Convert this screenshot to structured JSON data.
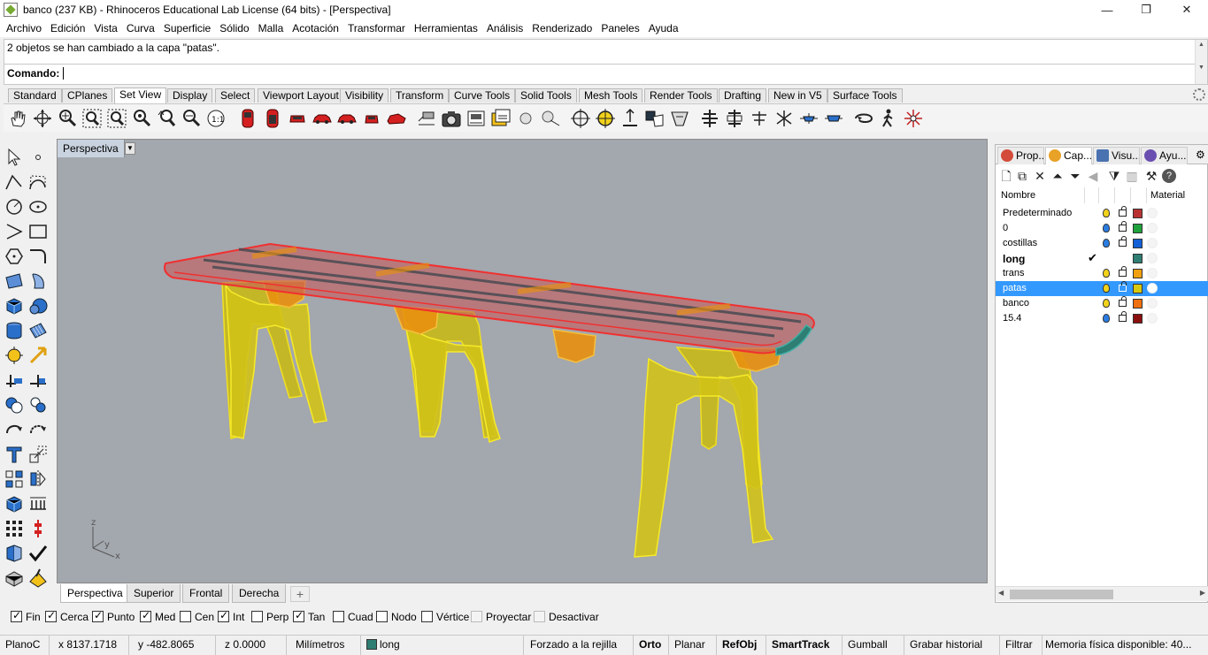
{
  "window": {
    "title": "banco (237 KB) - Rhinoceros Educational Lab License (64 bits) - [Perspectiva]"
  },
  "menu": [
    "Archivo",
    "Edición",
    "Vista",
    "Curva",
    "Superficie",
    "Sólido",
    "Malla",
    "Acotación",
    "Transformar",
    "Herramientas",
    "Análisis",
    "Renderizado",
    "Paneles",
    "Ayuda"
  ],
  "command": {
    "history": "2 objetos se han cambiado a la capa \"patas\".",
    "prompt": "Comando:"
  },
  "tabs": [
    "Standard",
    "CPlanes",
    "Set View",
    "Display",
    "Select",
    "Viewport Layout",
    "Visibility",
    "Transform",
    "Curve Tools",
    "Solid Tools",
    "Mesh Tools",
    "Render Tools",
    "Drafting",
    "New in V5",
    "Surface Tools"
  ],
  "active_tab": "Set View",
  "viewport": {
    "title": "Perspectiva",
    "axes": {
      "z": "z",
      "y": "y",
      "x": "x"
    }
  },
  "viewport_tabs": [
    "Perspectiva",
    "Superior",
    "Frontal",
    "Derecha"
  ],
  "panel": {
    "tabs": [
      {
        "label": "Prop...",
        "icon": "properties-icon",
        "color": "#d34b3a"
      },
      {
        "label": "Cap...",
        "icon": "layers-icon",
        "color": "#e8a227"
      },
      {
        "label": "Visu...",
        "icon": "display-icon",
        "color": "#4a72b0"
      },
      {
        "label": "Ayu...",
        "icon": "help-icon",
        "color": "#6a4fb0"
      }
    ],
    "header": {
      "name": "Nombre",
      "material": "Material"
    },
    "layers": [
      {
        "name": "Predeterminado",
        "color": "#b83232",
        "bulb": "#f2d21a",
        "current": false,
        "selected": false
      },
      {
        "name": "0",
        "color": "#1fa23b",
        "bulb": "#2a7de1",
        "current": false,
        "selected": false
      },
      {
        "name": "costillas",
        "color": "#1460d6",
        "bulb": "#2a7de1",
        "current": false,
        "selected": false
      },
      {
        "name": "long",
        "color": "#2e7e74",
        "bulb": "",
        "current": true,
        "selected": false
      },
      {
        "name": "trans",
        "color": "#f0a010",
        "bulb": "#f2d21a",
        "current": false,
        "selected": false
      },
      {
        "name": "patas",
        "color": "#d8c810",
        "bulb": "#f2d21a",
        "current": false,
        "selected": true
      },
      {
        "name": "banco",
        "color": "#f07010",
        "bulb": "#f2d21a",
        "current": false,
        "selected": false
      },
      {
        "name": "15.4",
        "color": "#8a1010",
        "bulb": "#2a7de1",
        "current": false,
        "selected": false
      }
    ]
  },
  "osnaps": [
    {
      "label": "Fin",
      "checked": true,
      "enabled": true
    },
    {
      "label": "Cerca",
      "checked": true,
      "enabled": true
    },
    {
      "label": "Punto",
      "checked": true,
      "enabled": true
    },
    {
      "label": "Med",
      "checked": true,
      "enabled": true
    },
    {
      "label": "Cen",
      "checked": false,
      "enabled": true
    },
    {
      "label": "Int",
      "checked": true,
      "enabled": true
    },
    {
      "label": "Perp",
      "checked": false,
      "enabled": true
    },
    {
      "label": "Tan",
      "checked": true,
      "enabled": true
    },
    {
      "label": "Cuad",
      "checked": false,
      "enabled": true
    },
    {
      "label": "Nodo",
      "checked": false,
      "enabled": true
    },
    {
      "label": "Vértice",
      "checked": false,
      "enabled": true
    },
    {
      "label": "Proyectar",
      "checked": false,
      "enabled": false
    },
    {
      "label": "Desactivar",
      "checked": false,
      "enabled": false
    }
  ],
  "status": {
    "cplane": "PlanoC",
    "x": "x 8137.1718",
    "y": "y -482.8065",
    "z": "z 0.0000",
    "units": "Milímetros",
    "layer": "long",
    "grid_snap": "Forzado a la rejilla",
    "ortho": "Orto",
    "planar": "Planar",
    "refobj": "RefObj",
    "smarttrack": "SmartTrack",
    "gumball": "Gumball",
    "history": "Grabar historial",
    "filter": "Filtrar",
    "memory": "Memoria física disponible: 40..."
  },
  "colors": {
    "accent": "#3399ff",
    "viewport_bg": "#a3a7ae",
    "seat_top": "#c75a5a",
    "legs": "#d2c218"
  }
}
